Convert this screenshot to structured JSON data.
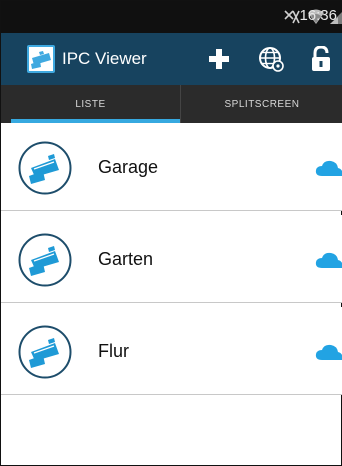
{
  "status_bar": {
    "time": "16:36",
    "icons": [
      "mute-icon",
      "wifi-icon",
      "signal-icon",
      "battery-icon"
    ]
  },
  "app_bar": {
    "title": "IPC Viewer",
    "actions": [
      "add-icon",
      "globe-settings-icon",
      "lock-icon"
    ],
    "background": "#17435f"
  },
  "tabs": [
    {
      "label": "LISTE",
      "active": true
    },
    {
      "label": "SPLITSCREEN",
      "active": false
    }
  ],
  "cameras": [
    {
      "name": "Garage",
      "status_icon": "cloud-icon"
    },
    {
      "name": "Garten",
      "status_icon": "cloud-icon"
    },
    {
      "name": "Flur",
      "status_icon": "cloud-icon"
    }
  ],
  "colors": {
    "accent": "#36a9e0",
    "camera_blue": "#1f9ad6",
    "circle_border": "#1d4d6b"
  }
}
